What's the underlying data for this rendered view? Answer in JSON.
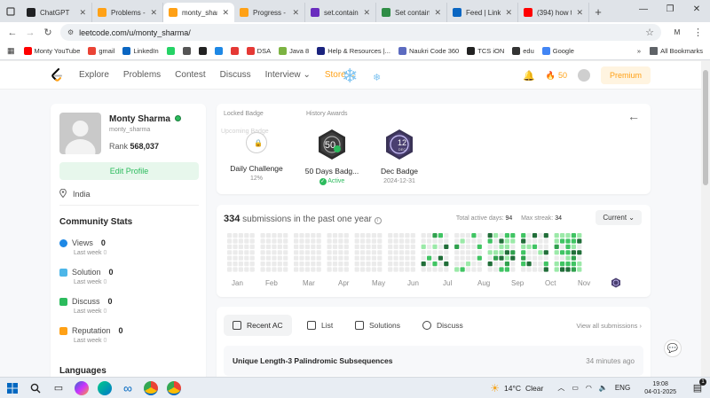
{
  "browser": {
    "tabs": [
      {
        "title": "ChatGPT",
        "color": "#202123",
        "active": false
      },
      {
        "title": "Problems - L",
        "color": "#ffa116",
        "active": false
      },
      {
        "title": "monty_sharm",
        "color": "#ffa116",
        "active": true
      },
      {
        "title": "Progress - L",
        "color": "#ffa116",
        "active": false
      },
      {
        "title": "set.contains",
        "color": "#6a2dbf",
        "active": false
      },
      {
        "title": "Set contains",
        "color": "#2f8d46",
        "active": false
      },
      {
        "title": "Feed | Linke",
        "color": "#0a66c2",
        "active": false
      },
      {
        "title": "(394) how to",
        "color": "#ff0000",
        "active": false
      }
    ],
    "new_tab": "+",
    "url": "leetcode.com/u/monty_sharma/",
    "profile_initial": "M",
    "bookmarks": [
      {
        "label": "Monty YouTube",
        "color": "#ff0000"
      },
      {
        "label": "gmail",
        "color": "#ea4335"
      },
      {
        "label": "LinkedIn",
        "color": "#0a66c2"
      },
      {
        "label": "",
        "color": "#25d366"
      },
      {
        "label": "",
        "color": "#555555"
      },
      {
        "label": "",
        "color": "#222222"
      },
      {
        "label": "",
        "color": "#1e88e5"
      },
      {
        "label": "",
        "color": "#e53935"
      },
      {
        "label": "DSA",
        "color": "#e53935"
      },
      {
        "label": "Java 8",
        "color": "#7cb342"
      },
      {
        "label": "Help & Resources |...",
        "color": "#1a237e"
      },
      {
        "label": "Naukri Code 360",
        "color": "#5c6bc0"
      },
      {
        "label": "TCS iON",
        "color": "#222222"
      },
      {
        "label": "edu",
        "color": "#333333"
      },
      {
        "label": "Google",
        "color": "#4285f4"
      }
    ],
    "bookmarks_more": "»",
    "all_bookmarks": "All Bookmarks"
  },
  "leetcode_nav": {
    "links": [
      "Explore",
      "Problems",
      "Contest",
      "Discuss",
      "Interview",
      "Store"
    ],
    "streak": "50",
    "premium": "Premium"
  },
  "profile": {
    "name": "Monty Sharma",
    "handle": "monty_sharma",
    "rank_label": "Rank",
    "rank_value": "568,037",
    "edit_label": "Edit Profile",
    "location": "India",
    "community_title": "Community Stats",
    "stats": [
      {
        "label": "Views",
        "value": "0",
        "last_week_label": "Last week",
        "last_week": "0",
        "color": "#1e88e5"
      },
      {
        "label": "Solution",
        "value": "0",
        "last_week_label": "Last week",
        "last_week": "0",
        "color": "#4db6e8"
      },
      {
        "label": "Discuss",
        "value": "0",
        "last_week_label": "Last week",
        "last_week": "0",
        "color": "#2cbb5d"
      },
      {
        "label": "Reputation",
        "value": "0",
        "last_week_label": "Last week",
        "last_week": "0",
        "color": "#ffa116"
      }
    ],
    "languages_title": "Languages"
  },
  "badges": {
    "locked_label": "Locked Badge",
    "history_label": "History Awards",
    "locked_img_alt": "Upcoming Badge",
    "items": [
      {
        "name": "Daily Challenge",
        "sub": "12%"
      },
      {
        "name": "50 Days Badg...",
        "sub": "Active"
      },
      {
        "name": "Dec Badge",
        "sub": "2024-12-31"
      }
    ],
    "badge50_text": "50",
    "badgeDec_text": "12",
    "badgeDec_sub": "DEC"
  },
  "submissions": {
    "count": "334",
    "text": "submissions in the past one year",
    "active_days_label": "Total active days:",
    "active_days": "94",
    "max_streak_label": "Max streak:",
    "max_streak": "34",
    "range": "Current",
    "months": [
      "Jan",
      "Feb",
      "Mar",
      "Apr",
      "May",
      "Jun",
      "Jul",
      "Aug",
      "Sep",
      "Oct",
      "Nov"
    ]
  },
  "recent": {
    "tabs": [
      "Recent AC",
      "List",
      "Solutions",
      "Discuss"
    ],
    "view_all": "View all submissions",
    "items": [
      {
        "title": "Unique Length-3 Palindromic Subsequences",
        "ago": "34 minutes ago"
      }
    ]
  },
  "taskbar": {
    "temp": "14°C",
    "weather": "Clear",
    "lang": "ENG",
    "time": "19:08",
    "date": "04-01-2025",
    "weather_badge": "1"
  }
}
